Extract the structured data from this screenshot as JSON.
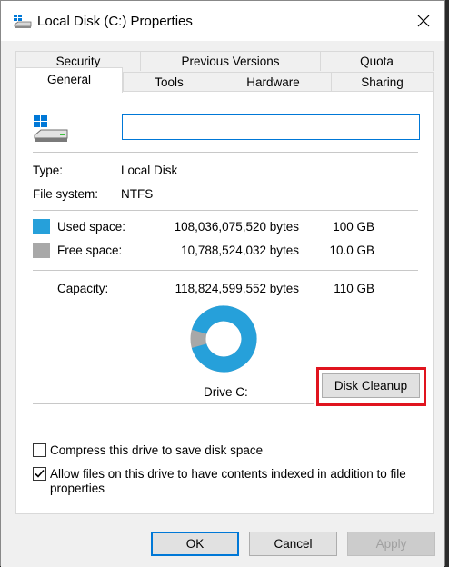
{
  "window": {
    "title": "Local Disk (C:) Properties"
  },
  "tabs": {
    "row1": [
      "Security",
      "Previous Versions",
      "Quota"
    ],
    "row2": [
      "General",
      "Tools",
      "Hardware",
      "Sharing"
    ],
    "active": "General"
  },
  "general": {
    "name_value": "",
    "type_label": "Type:",
    "type_value": "Local Disk",
    "fs_label": "File system:",
    "fs_value": "NTFS",
    "used_label": "Used space:",
    "used_bytes": "108,036,075,520 bytes",
    "used_size": "100 GB",
    "free_label": "Free space:",
    "free_bytes": "10,788,524,032 bytes",
    "free_size": "10.0 GB",
    "capacity_label": "Capacity:",
    "capacity_bytes": "118,824,599,552 bytes",
    "capacity_size": "110 GB",
    "drive_label": "Drive C:",
    "cleanup_label": "Disk Cleanup",
    "used_fraction": 0.909,
    "compress_label": "Compress this drive to save disk space",
    "compress_checked": false,
    "index_label_line1": "Allow files on this drive to have contents indexed in addition to file",
    "index_label_line2": "properties",
    "index_checked": true
  },
  "colors": {
    "used": "#26a0da",
    "free": "#a8a8a8",
    "accent": "#0078d7",
    "highlight": "#e0141e"
  },
  "buttons": {
    "ok": "OK",
    "cancel": "Cancel",
    "apply": "Apply"
  }
}
